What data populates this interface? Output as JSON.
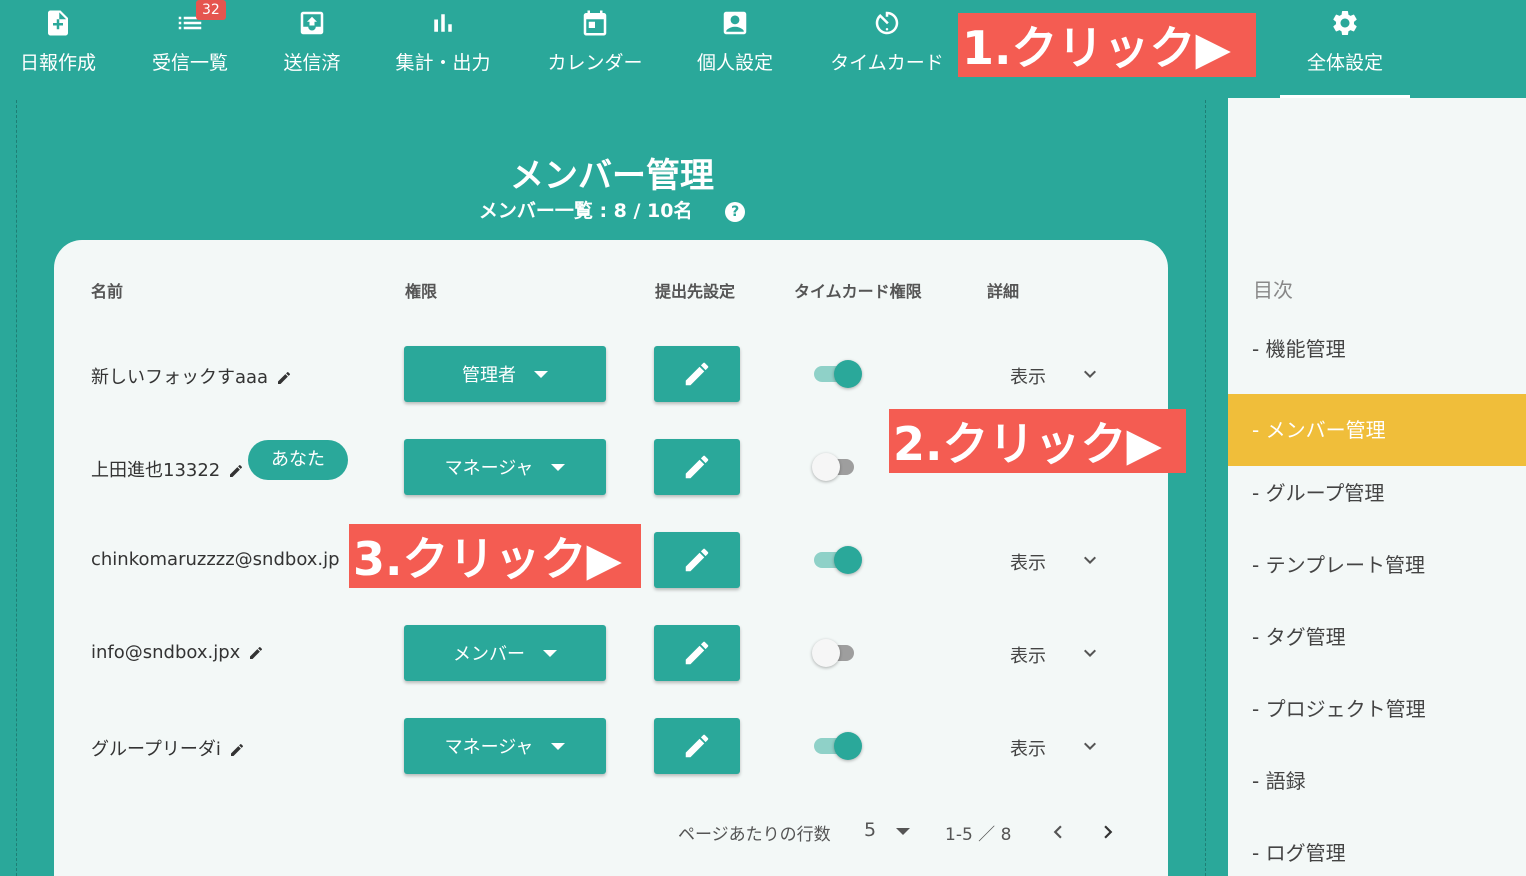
{
  "nav": {
    "items": [
      {
        "label": "日報作成",
        "icon": "file-plus-icon"
      },
      {
        "label": "受信一覧",
        "icon": "list-icon",
        "badge": "32"
      },
      {
        "label": "送信済",
        "icon": "outbox-icon"
      },
      {
        "label": "集計・出力",
        "icon": "bar-chart-icon"
      },
      {
        "label": "カレンダー",
        "icon": "calendar-icon"
      },
      {
        "label": "個人設定",
        "icon": "person-card-icon"
      },
      {
        "label": "タイムカード",
        "icon": "timer-icon"
      },
      {
        "label": "全体設定",
        "icon": "gear-icon",
        "active": true
      }
    ]
  },
  "annotations": {
    "step1": "1.クリック▶",
    "step2": "2.クリック▶",
    "step3": "3.クリック▶",
    "color": "#f45c52"
  },
  "main": {
    "title": "メンバー管理",
    "subtitle": "メンバー一覧 : 8 / 10名",
    "help_icon": "?"
  },
  "table": {
    "headers": [
      "名前",
      "権限",
      "提出先設定",
      "タイムカード権限",
      "詳細"
    ],
    "rows": [
      {
        "name": "新しいフォックすaaa",
        "role": "管理者",
        "timecard": true,
        "detail": "表示"
      },
      {
        "name": "上田進也13322",
        "you": "あなた",
        "role": "マネージャ",
        "timecard": false,
        "detail": ""
      },
      {
        "name": "chinkomaruzzzz@sndbox.jp",
        "role": "",
        "timecard": true,
        "detail": "表示"
      },
      {
        "name": "info@sndbox.jpx",
        "role": "メンバー",
        "timecard": false,
        "detail": "表示"
      },
      {
        "name": "グループリーダi",
        "role": "マネージャ",
        "timecard": true,
        "detail": "表示"
      }
    ]
  },
  "pager": {
    "rows_per_page_label": "ページあたりの行数",
    "rows_per_page": "5",
    "range": "1-5 ／ 8"
  },
  "sidebar": {
    "title": "目次",
    "items": [
      {
        "label": "- 機能管理"
      },
      {
        "label": "- メンバー管理",
        "active": true
      },
      {
        "label": "- グループ管理"
      },
      {
        "label": "- テンプレート管理"
      },
      {
        "label": "- タグ管理"
      },
      {
        "label": "- プロジェクト管理"
      },
      {
        "label": "- 語録"
      },
      {
        "label": "- ログ管理"
      }
    ]
  },
  "colors": {
    "primary": "#2aa89a",
    "sidebar_active": "#f0be3a",
    "badge": "#e5554f"
  }
}
